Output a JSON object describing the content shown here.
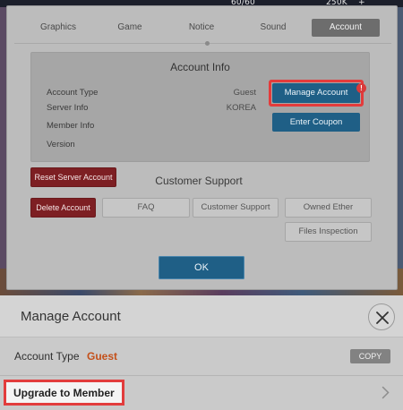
{
  "background": {
    "hud_stats": [
      "60/60",
      "250K",
      "+"
    ]
  },
  "settings": {
    "tabs": [
      {
        "label": "Graphics",
        "active": false
      },
      {
        "label": "Game",
        "active": false
      },
      {
        "label": "Notice",
        "active": false
      },
      {
        "label": "Sound",
        "active": false
      },
      {
        "label": "Account",
        "active": true
      }
    ],
    "account_info": {
      "title": "Account Info",
      "rows": [
        {
          "label": "Account Type",
          "value": "Guest"
        },
        {
          "label": "Server Info",
          "value": "KOREA"
        },
        {
          "label": "Member Info",
          "value": ""
        },
        {
          "label": "Version",
          "value": ""
        }
      ],
      "manage_account_label": "Manage Account",
      "alert_badge": "!",
      "enter_coupon_label": "Enter Coupon"
    },
    "customer_support": {
      "title": "Customer Support",
      "reset_server_label": "Reset Server Account",
      "delete_account_label": "Delete Account",
      "faq_label": "FAQ",
      "support_label": "Customer Support",
      "owned_ether_label": "Owned Ether",
      "files_inspection_label": "Files Inspection"
    },
    "ok_label": "OK"
  },
  "sheet": {
    "title": "Manage Account",
    "account_type_label": "Account Type",
    "account_type_value": "Guest",
    "copy_label": "COPY",
    "upgrade_label": "Upgrade to Member"
  },
  "colors": {
    "primary_blue": "#1f5f86",
    "danger_red": "#7d1f23",
    "highlight_red": "#e43b3b",
    "guest_orange": "#c4501a"
  }
}
